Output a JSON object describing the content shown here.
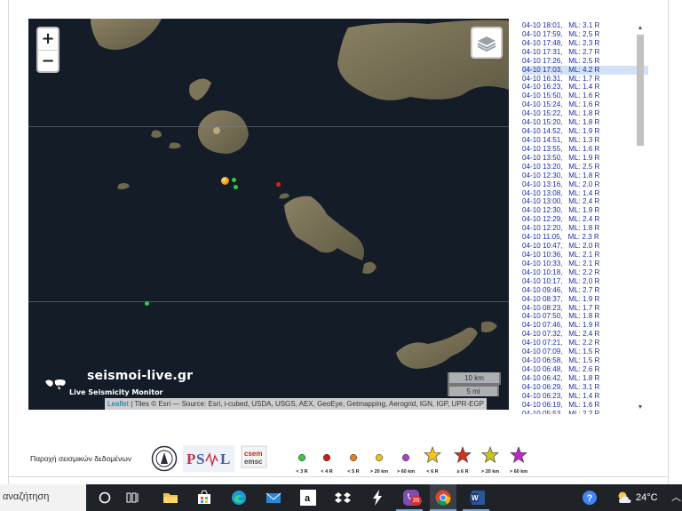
{
  "map": {
    "zoom_in": "+",
    "zoom_out": "−",
    "brand_name": "seismoi-live.gr",
    "brand_subtitle": "Live Seismicity Monitor",
    "scale_metric": "10 km",
    "scale_imperial": "5 mi",
    "attribution_link": "Leaflet",
    "attribution_text": " | Tiles © Esri — Source: Esri, i-cubed, USDA, USGS, AEX, GeoEye, Getmapping, Aerogrid, IGN, IGP, UPR-EGP",
    "colors": {
      "water": "#141c27",
      "land": "#7b725a",
      "green_marker": "#2ecc40",
      "red_marker": "#e0201a",
      "orange_marker": "#f39c12"
    }
  },
  "events": [
    "04-10 18:01,   ML: 3.1 R",
    "04-10 17:59,   ML: 2.5 R",
    "04-10 17:48,   ML: 2.3 R",
    "04-10 17:31,   ML: 2.7 R",
    "04-10 17:26,   ML: 2.5 R",
    "04-10 17:03,   ML: 4.2 R",
    "04-10 16:31,   ML: 1.7 R",
    "04-10 16:23,   ML: 1.4 R",
    "04-10 15:50,   ML: 1.6 R",
    "04-10 15:24,   ML: 1.6 R",
    "04-10 15:22,   ML: 1.8 R",
    "04-10 15:20,   ML: 1.8 R",
    "04-10 14:52,   ML: 1.9 R",
    "04-10 14:51,   ML: 1.3 R",
    "04-10 13:55,   ML: 1.6 R",
    "04-10 13:50,   ML: 1.9 R",
    "04-10 13:20,   ML: 2.5 R",
    "04-10 12:30,   ML: 1.8 R",
    "04-10 13:16,   ML: 2.0 R",
    "04-10 13:08,   ML: 1.4 R",
    "04-10 13:00,   ML: 2.4 R",
    "04-10 12:30,   ML: 1.9 R",
    "04-10 12:29,   ML: 2.4 R",
    "04-10 12:20,   ML: 1.8 R",
    "04-10 11:05,   ML: 2.3 R",
    "04-10 10:47,   ML: 2.0 R",
    "04-10 10:36,   ML: 2.1 R",
    "04-10 10:33,   ML: 2.1 R",
    "04-10 10:18,   ML: 2.2 R",
    "04-10 10:17,   ML: 2.0 R",
    "04-10 09:46,   ML: 2.7 R",
    "04-10 08:37,   ML: 1.9 R",
    "04-10 08:23,   ML: 1.7 R",
    "04-10 07:50,   ML: 1.8 R",
    "04-10 07:46,   ML: 1.9 R",
    "04-10 07:32,   ML: 2.4 R",
    "04-10 07:21,   ML: 2.2 R",
    "04-10 07:09,   ML: 1.5 R",
    "04-10 06:58,   ML: 1.5 R",
    "04-10 06:48,   ML: 2.6 R",
    "04-10 06:42,   ML: 1.8 R",
    "04-10 06:29,   ML: 3.1 R",
    "04-10 06:23,   ML: 1.4 R",
    "04-10 06:19,   ML: 1.6 R",
    "04-10 05:53,   ML: 2.2 R"
  ],
  "selected_event_index": 5,
  "legend": {
    "provider": "Παροχή σεισμικών δεδομένων",
    "logo_noa_text": "",
    "logo_psl_text": "P S L",
    "logo_csem_text": "csem emsc",
    "items": [
      {
        "label": "< 3 R",
        "shape": "dot",
        "color": "#2ecc40"
      },
      {
        "label": "< 4 R",
        "shape": "dot",
        "color": "#d31a15"
      },
      {
        "label": "< 5 R",
        "shape": "dot",
        "color": "#e67e22"
      },
      {
        "label": "> 20 km",
        "shape": "dot",
        "color": "#e8c21b"
      },
      {
        "label": "> 60 km",
        "shape": "dot",
        "color": "#b03fc5"
      },
      {
        "label": "< 6 R",
        "shape": "star",
        "color": "#f5c518"
      },
      {
        "label": "≥ 6 R",
        "shape": "star",
        "color": "#d6301c"
      },
      {
        "label": "> 20 km",
        "shape": "star",
        "color": "#c9c41b"
      },
      {
        "label": "> 60 km",
        "shape": "star",
        "color": "#c026c9"
      }
    ]
  },
  "taskbar": {
    "search_text": "αναζήτηση",
    "notification_count": "36",
    "temperature": "24°C",
    "icons": [
      "task-view-icon",
      "taskview-grid-icon",
      "file-explorer-icon",
      "store-icon",
      "edge-icon",
      "mail-icon",
      "amazon-icon",
      "dropbox-icon",
      "bolt-icon",
      "viber-icon",
      "chrome-icon",
      "word-icon"
    ]
  }
}
